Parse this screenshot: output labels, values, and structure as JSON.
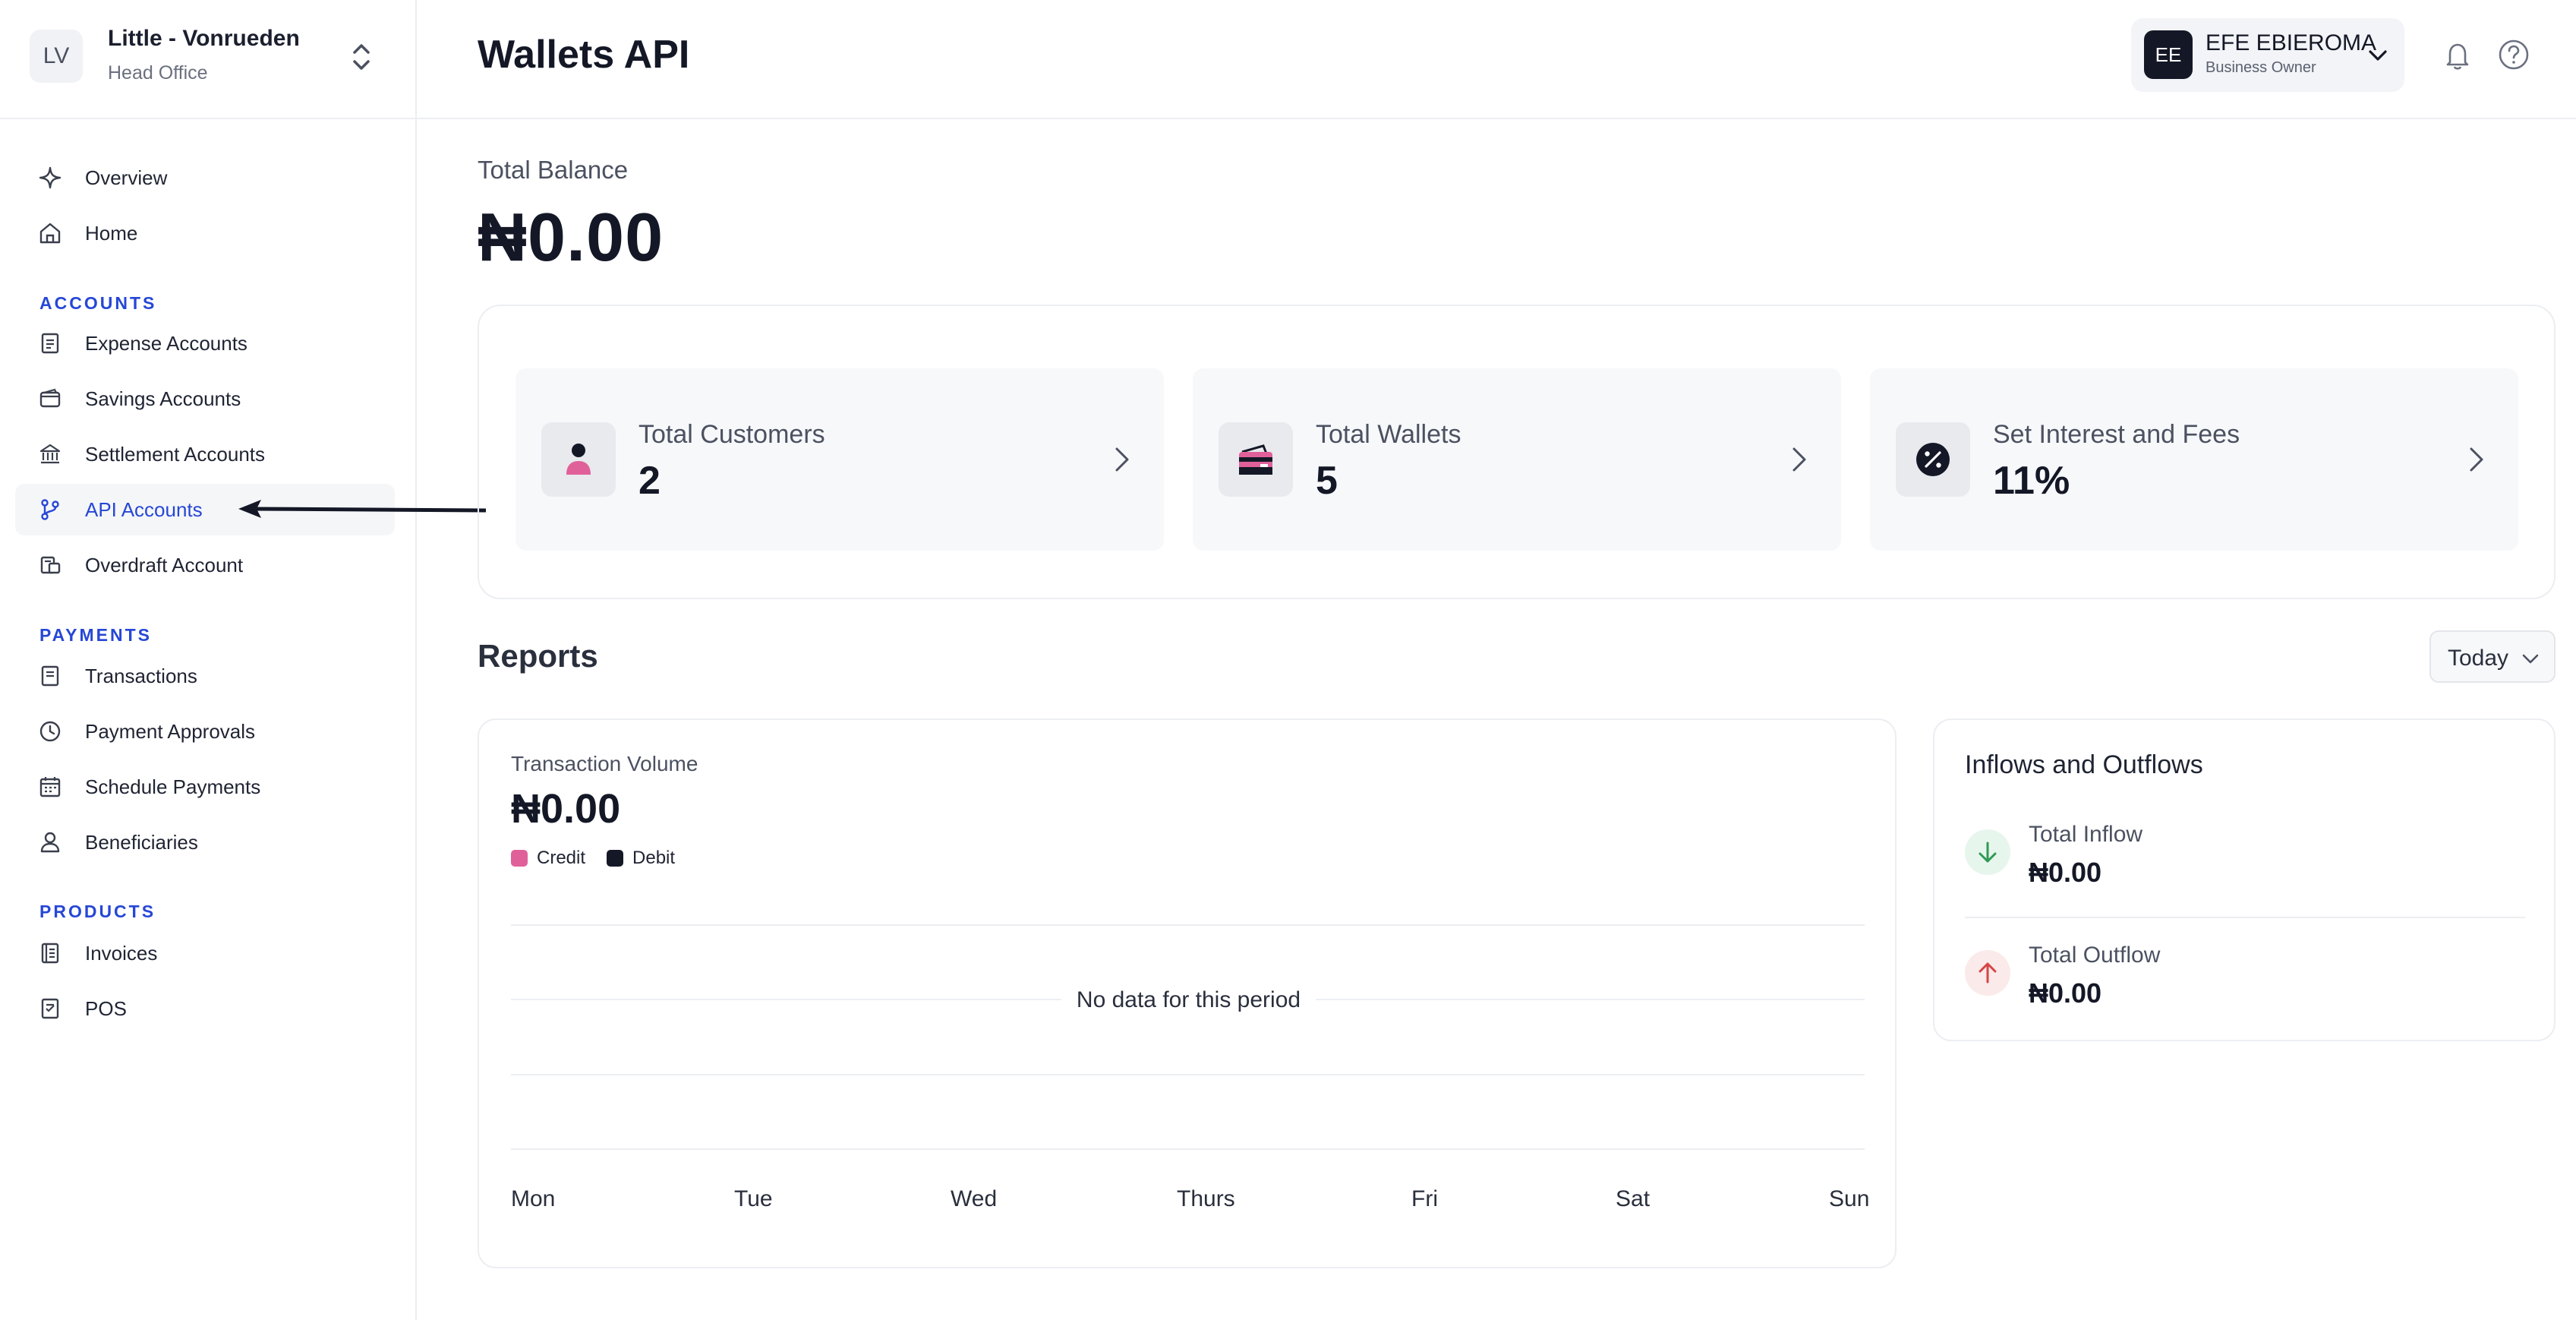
{
  "org": {
    "initials": "LV",
    "name": "Little - Vonrueden",
    "branch": "Head Office"
  },
  "sidebar": {
    "top_items": [
      {
        "label": "Overview",
        "icon": "sparkle-icon"
      },
      {
        "label": "Home",
        "icon": "home-icon"
      }
    ],
    "sections": [
      {
        "title": "ACCOUNTS",
        "items": [
          {
            "label": "Expense Accounts",
            "icon": "receipt-icon"
          },
          {
            "label": "Savings Accounts",
            "icon": "wallet-icon"
          },
          {
            "label": "Settlement Accounts",
            "icon": "bank-icon"
          },
          {
            "label": "API Accounts",
            "icon": "git-branch-icon",
            "active": true
          },
          {
            "label": "Overdraft Account",
            "icon": "overdraft-icon"
          }
        ]
      },
      {
        "title": "PAYMENTS",
        "items": [
          {
            "label": "Transactions",
            "icon": "document-icon"
          },
          {
            "label": "Payment Approvals",
            "icon": "clock-icon"
          },
          {
            "label": "Schedule Payments",
            "icon": "calendar-icon"
          },
          {
            "label": "Beneficiaries",
            "icon": "user-icon"
          }
        ]
      },
      {
        "title": "PRODUCTS",
        "items": [
          {
            "label": "Invoices",
            "icon": "invoice-icon"
          },
          {
            "label": "POS",
            "icon": "pos-icon"
          }
        ]
      }
    ]
  },
  "header": {
    "title": "Wallets API",
    "user": {
      "initials": "EE",
      "name": "EFE EBIEROMA",
      "role": "Business Owner"
    }
  },
  "balance": {
    "label": "Total Balance",
    "value": "₦0.00"
  },
  "stats": [
    {
      "label": "Total Customers",
      "value": "2",
      "icon": "person-icon"
    },
    {
      "label": "Total Wallets",
      "value": "5",
      "icon": "card-icon"
    },
    {
      "label": "Set Interest and Fees",
      "value": "11%",
      "icon": "percent-icon"
    }
  ],
  "reports": {
    "title": "Reports",
    "period": "Today"
  },
  "volume": {
    "label": "Transaction Volume",
    "value": "₦0.00",
    "legend": [
      {
        "label": "Credit",
        "color": "#e0619a"
      },
      {
        "label": "Debit",
        "color": "#141826"
      }
    ],
    "empty_text": "No data for this period",
    "days": [
      "Mon",
      "Tue",
      "Wed",
      "Thurs",
      "Fri",
      "Sat",
      "Sun"
    ]
  },
  "flows": {
    "title": "Inflows and Outflows",
    "inflow": {
      "label": "Total Inflow",
      "value": "₦0.00",
      "color": "#2e9a55"
    },
    "outflow": {
      "label": "Total Outflow",
      "value": "₦0.00",
      "color": "#d64545"
    }
  },
  "colors": {
    "accent": "#2647d6",
    "credit": "#e0619a",
    "debit": "#141826"
  }
}
